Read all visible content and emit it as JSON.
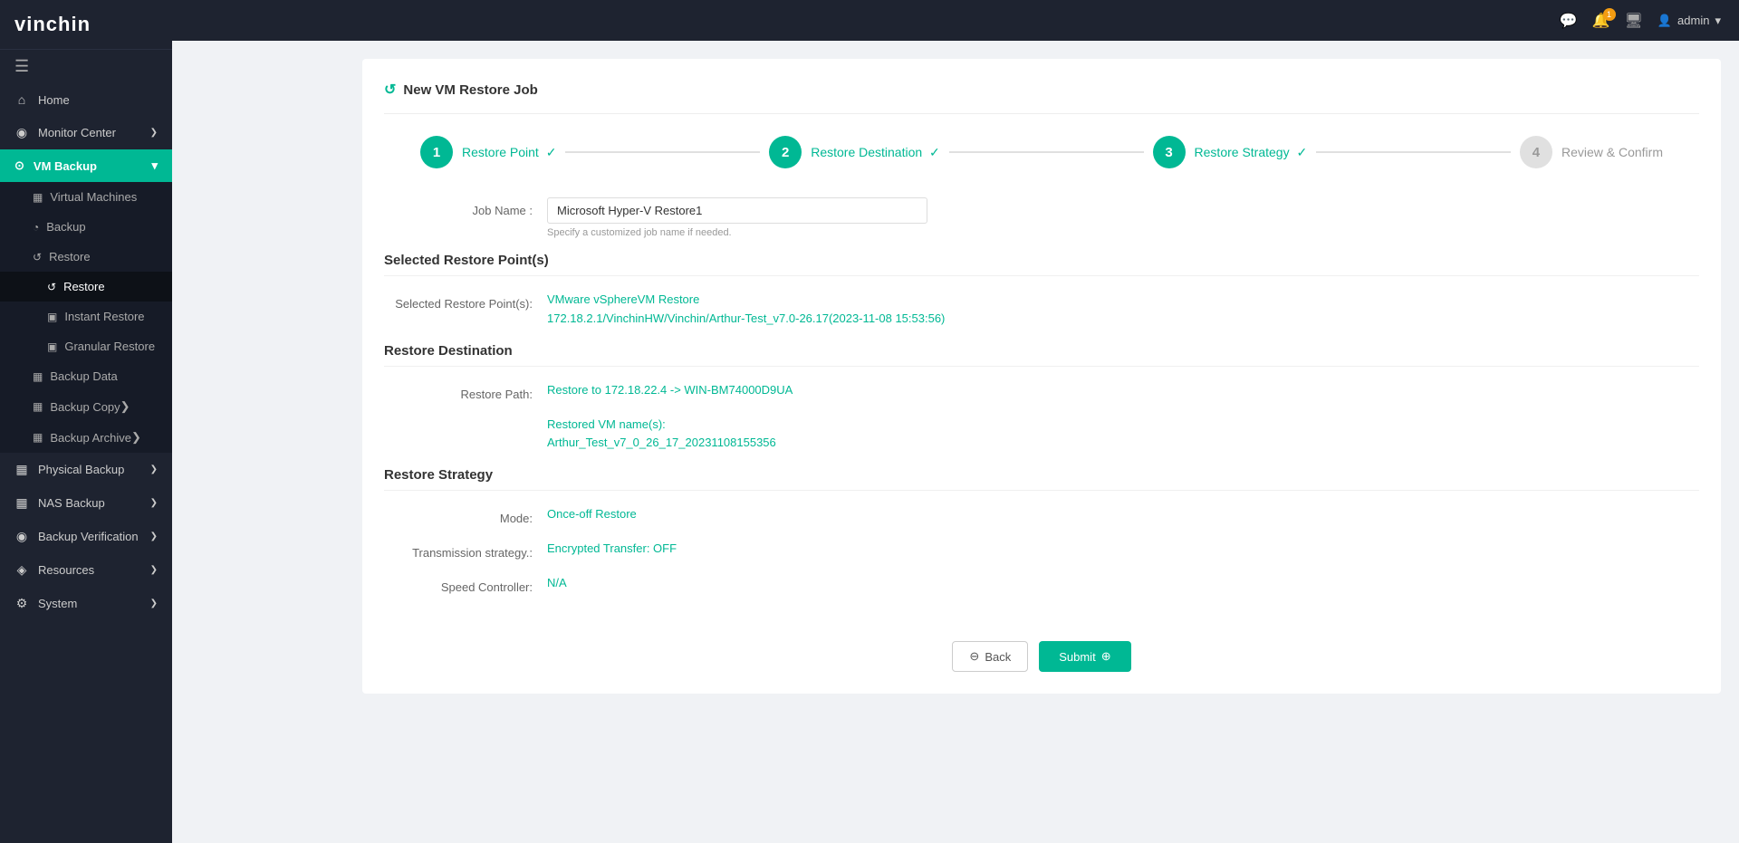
{
  "logo": {
    "part1": "vin",
    "part2": "chin"
  },
  "topbar": {
    "notification_count": "1",
    "user_label": "admin"
  },
  "sidebar": {
    "toggle_icon": "☰",
    "items": [
      {
        "id": "home",
        "icon": "⌂",
        "label": "Home",
        "active": false
      },
      {
        "id": "monitor-center",
        "icon": "◉",
        "label": "Monitor Center",
        "active": false,
        "arrow": "❯"
      },
      {
        "id": "vm-backup",
        "icon": "⊙",
        "label": "VM Backup",
        "active": true,
        "arrow": "▾"
      }
    ],
    "vm_backup_sub": [
      {
        "id": "virtual-machines",
        "icon": "▦",
        "label": "Virtual Machines"
      },
      {
        "id": "backup",
        "icon": "◔",
        "label": "Backup"
      },
      {
        "id": "restore",
        "icon": "↺",
        "label": "Restore",
        "expanded": true
      },
      {
        "id": "restore-sub",
        "icon": "↺",
        "label": "Restore",
        "indent": true
      },
      {
        "id": "instant-restore",
        "icon": "▣",
        "label": "Instant Restore",
        "indent": true
      },
      {
        "id": "granular-restore",
        "icon": "▣",
        "label": "Granular Restore",
        "indent": true
      },
      {
        "id": "backup-data",
        "icon": "▦",
        "label": "Backup Data"
      },
      {
        "id": "backup-copy",
        "icon": "▦",
        "label": "Backup Copy",
        "arrow": "❯"
      },
      {
        "id": "backup-archive",
        "icon": "▦",
        "label": "Backup Archive",
        "arrow": "❯"
      }
    ],
    "bottom_items": [
      {
        "id": "physical-backup",
        "icon": "▦",
        "label": "Physical Backup",
        "arrow": "❯"
      },
      {
        "id": "nas-backup",
        "icon": "▦",
        "label": "NAS Backup",
        "arrow": "❯"
      },
      {
        "id": "backup-verification",
        "icon": "◉",
        "label": "Backup Verification",
        "arrow": "❯"
      },
      {
        "id": "resources",
        "icon": "◈",
        "label": "Resources",
        "arrow": "❯"
      },
      {
        "id": "system",
        "icon": "⚙",
        "label": "System",
        "arrow": "❯"
      }
    ]
  },
  "page": {
    "title": "New VM Restore Job",
    "steps": [
      {
        "number": "1",
        "label": "Restore Point",
        "check": "✓",
        "active": true
      },
      {
        "number": "2",
        "label": "Restore Destination",
        "check": "✓",
        "active": true
      },
      {
        "number": "3",
        "label": "Restore Strategy",
        "check": "✓",
        "active": true
      },
      {
        "number": "4",
        "label": "Review & Confirm",
        "active": false
      }
    ],
    "job_name_label": "Job Name :",
    "job_name_value": "Microsoft Hyper-V Restore1",
    "job_name_hint": "Specify a customized job name if needed.",
    "selected_restore_points_title": "Selected Restore Point(s)",
    "selected_restore_points_label": "Selected Restore Point(s):",
    "restore_point_line1": "VMware vSphereVM Restore",
    "restore_point_line2": "172.18.2.1/VinchinHW/Vinchin/Arthur-Test_v7.0-26.17(2023-11-08 15:53:56)",
    "restore_destination_title": "Restore Destination",
    "restore_path_label": "Restore Path:",
    "restore_path_value": "Restore to 172.18.22.4 -> WIN-BM74000D9UA",
    "restored_vm_name_label": "Restored VM name(s):",
    "restored_vm_name_value": "Arthur_Test_v7_0_26_17_20231108155356",
    "restore_strategy_title": "Restore Strategy",
    "mode_label": "Mode:",
    "mode_value": "Once-off Restore",
    "transmission_label": "Transmission strategy.:",
    "transmission_value": "Encrypted Transfer: OFF",
    "speed_label": "Speed Controller:",
    "speed_value": "N/A",
    "btn_back": "Back",
    "btn_submit": "Submit"
  }
}
